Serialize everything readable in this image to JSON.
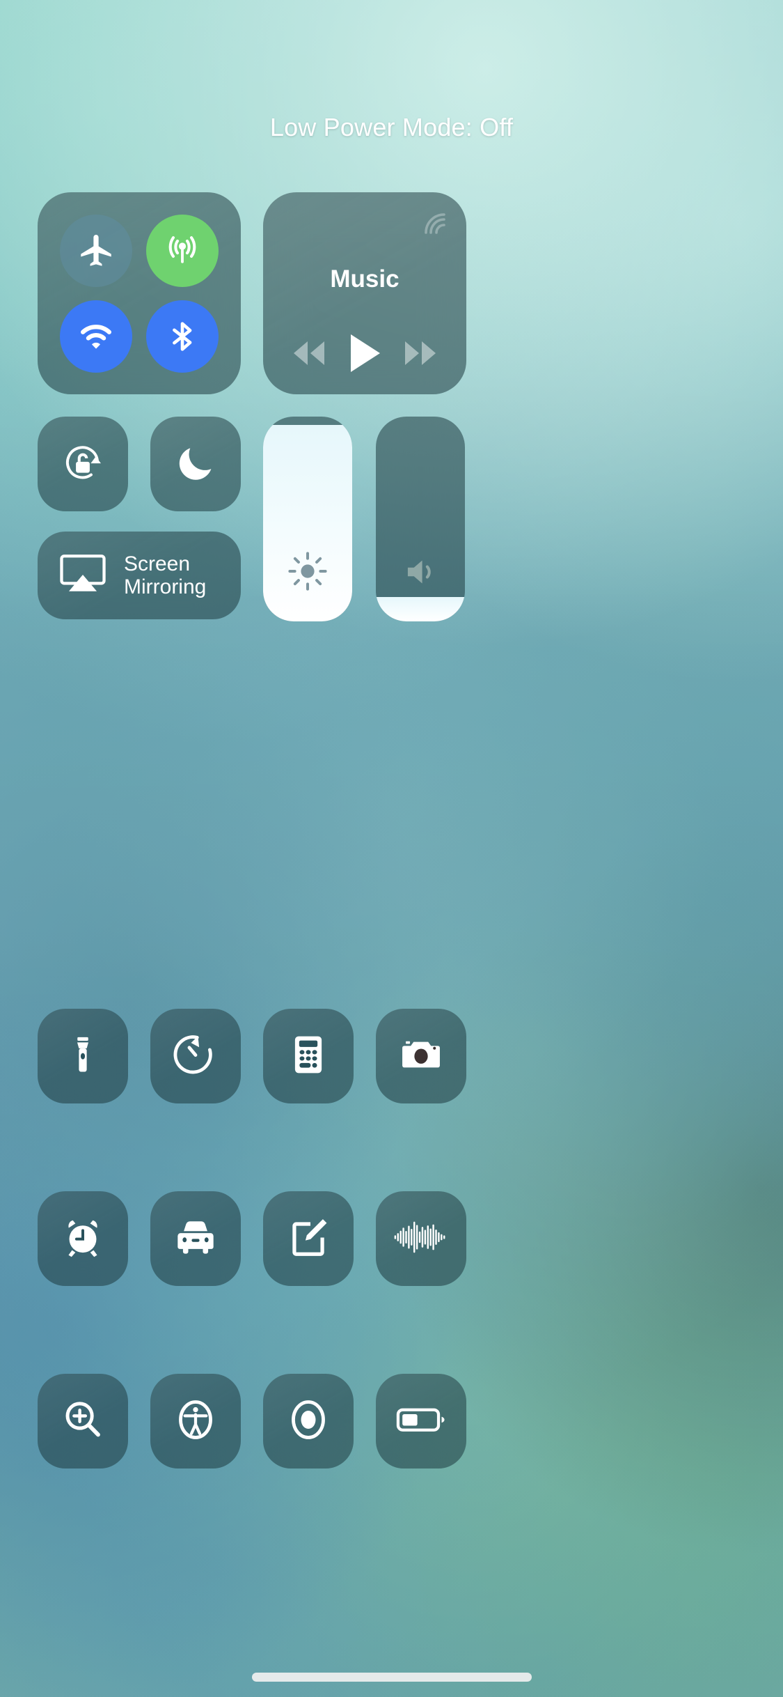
{
  "screen": {
    "name": "Control Center",
    "status_banner": "Low Power Mode: Off"
  },
  "colors": {
    "toggle_on_green": "#6fd26f",
    "toggle_on_blue": "#3c79f5",
    "toggle_off": "#608c9e",
    "tile_background": "rgba(30,58,64,0.55)",
    "slider_fill": "#ffffff",
    "text": "#ffffff",
    "wallpaper_base": "#6aa3b5"
  },
  "connectivity": {
    "name": "connectivity-module",
    "toggles": [
      {
        "name": "airplane-mode",
        "label": "Airplane Mode",
        "icon": "airplane-icon",
        "state": "off"
      },
      {
        "name": "cellular-data",
        "label": "Cellular Data",
        "icon": "cellular-icon",
        "state": "on"
      },
      {
        "name": "wifi",
        "label": "Wi-Fi",
        "icon": "wifi-icon",
        "state": "on"
      },
      {
        "name": "bluetooth",
        "label": "Bluetooth",
        "icon": "bluetooth-icon",
        "state": "on"
      }
    ]
  },
  "music": {
    "title": "Music",
    "airplay_icon": "airplay-audio-icon",
    "controls": [
      {
        "name": "rewind-button",
        "label": "Rewind",
        "icon": "rewind-icon",
        "state": "dim"
      },
      {
        "name": "play-button",
        "label": "Play",
        "icon": "play-icon",
        "state": "active"
      },
      {
        "name": "fast-forward-button",
        "label": "Fast Forward",
        "icon": "fast-forward-icon",
        "state": "dim"
      }
    ]
  },
  "toggles_row": [
    {
      "name": "rotation-lock",
      "label": "Portrait Orientation Lock",
      "icon": "rotation-lock-icon",
      "state": "off"
    },
    {
      "name": "do-not-disturb",
      "label": "Do Not Disturb",
      "icon": "moon-icon",
      "state": "off"
    }
  ],
  "screen_mirroring": {
    "label_line1": "Screen",
    "label_line2": "Mirroring",
    "icon": "airplay-screen-icon"
  },
  "sliders": [
    {
      "name": "brightness-slider",
      "label": "Brightness",
      "icon": "brightness-sun-icon",
      "value_percent": 96
    },
    {
      "name": "volume-slider",
      "label": "Volume",
      "icon": "volume-speaker-icon",
      "value_percent": 12
    }
  ],
  "utilities": [
    {
      "name": "flashlight-tile",
      "label": "Flashlight",
      "icon": "flashlight-icon"
    },
    {
      "name": "timer-tile",
      "label": "Timer",
      "icon": "timer-icon"
    },
    {
      "name": "calculator-tile",
      "label": "Calculator",
      "icon": "calculator-icon"
    },
    {
      "name": "camera-tile",
      "label": "Camera",
      "icon": "camera-icon"
    },
    {
      "name": "alarm-tile",
      "label": "Alarm",
      "icon": "alarm-clock-icon"
    },
    {
      "name": "driving-focus-tile",
      "label": "Do Not Disturb While Driving",
      "icon": "car-icon"
    },
    {
      "name": "notes-tile",
      "label": "Notes",
      "icon": "notes-compose-icon"
    },
    {
      "name": "voice-memos-tile",
      "label": "Voice Memos",
      "icon": "waveform-icon"
    },
    {
      "name": "magnifier-tile",
      "label": "Magnifier",
      "icon": "magnifier-icon"
    },
    {
      "name": "accessibility-tile",
      "label": "Accessibility Shortcuts",
      "icon": "accessibility-icon"
    },
    {
      "name": "screen-recording-tile",
      "label": "Screen Recording",
      "icon": "screen-record-icon"
    },
    {
      "name": "low-power-mode-tile",
      "label": "Low Power Mode",
      "icon": "battery-icon"
    }
  ],
  "home_indicator": {
    "name": "home-indicator"
  }
}
